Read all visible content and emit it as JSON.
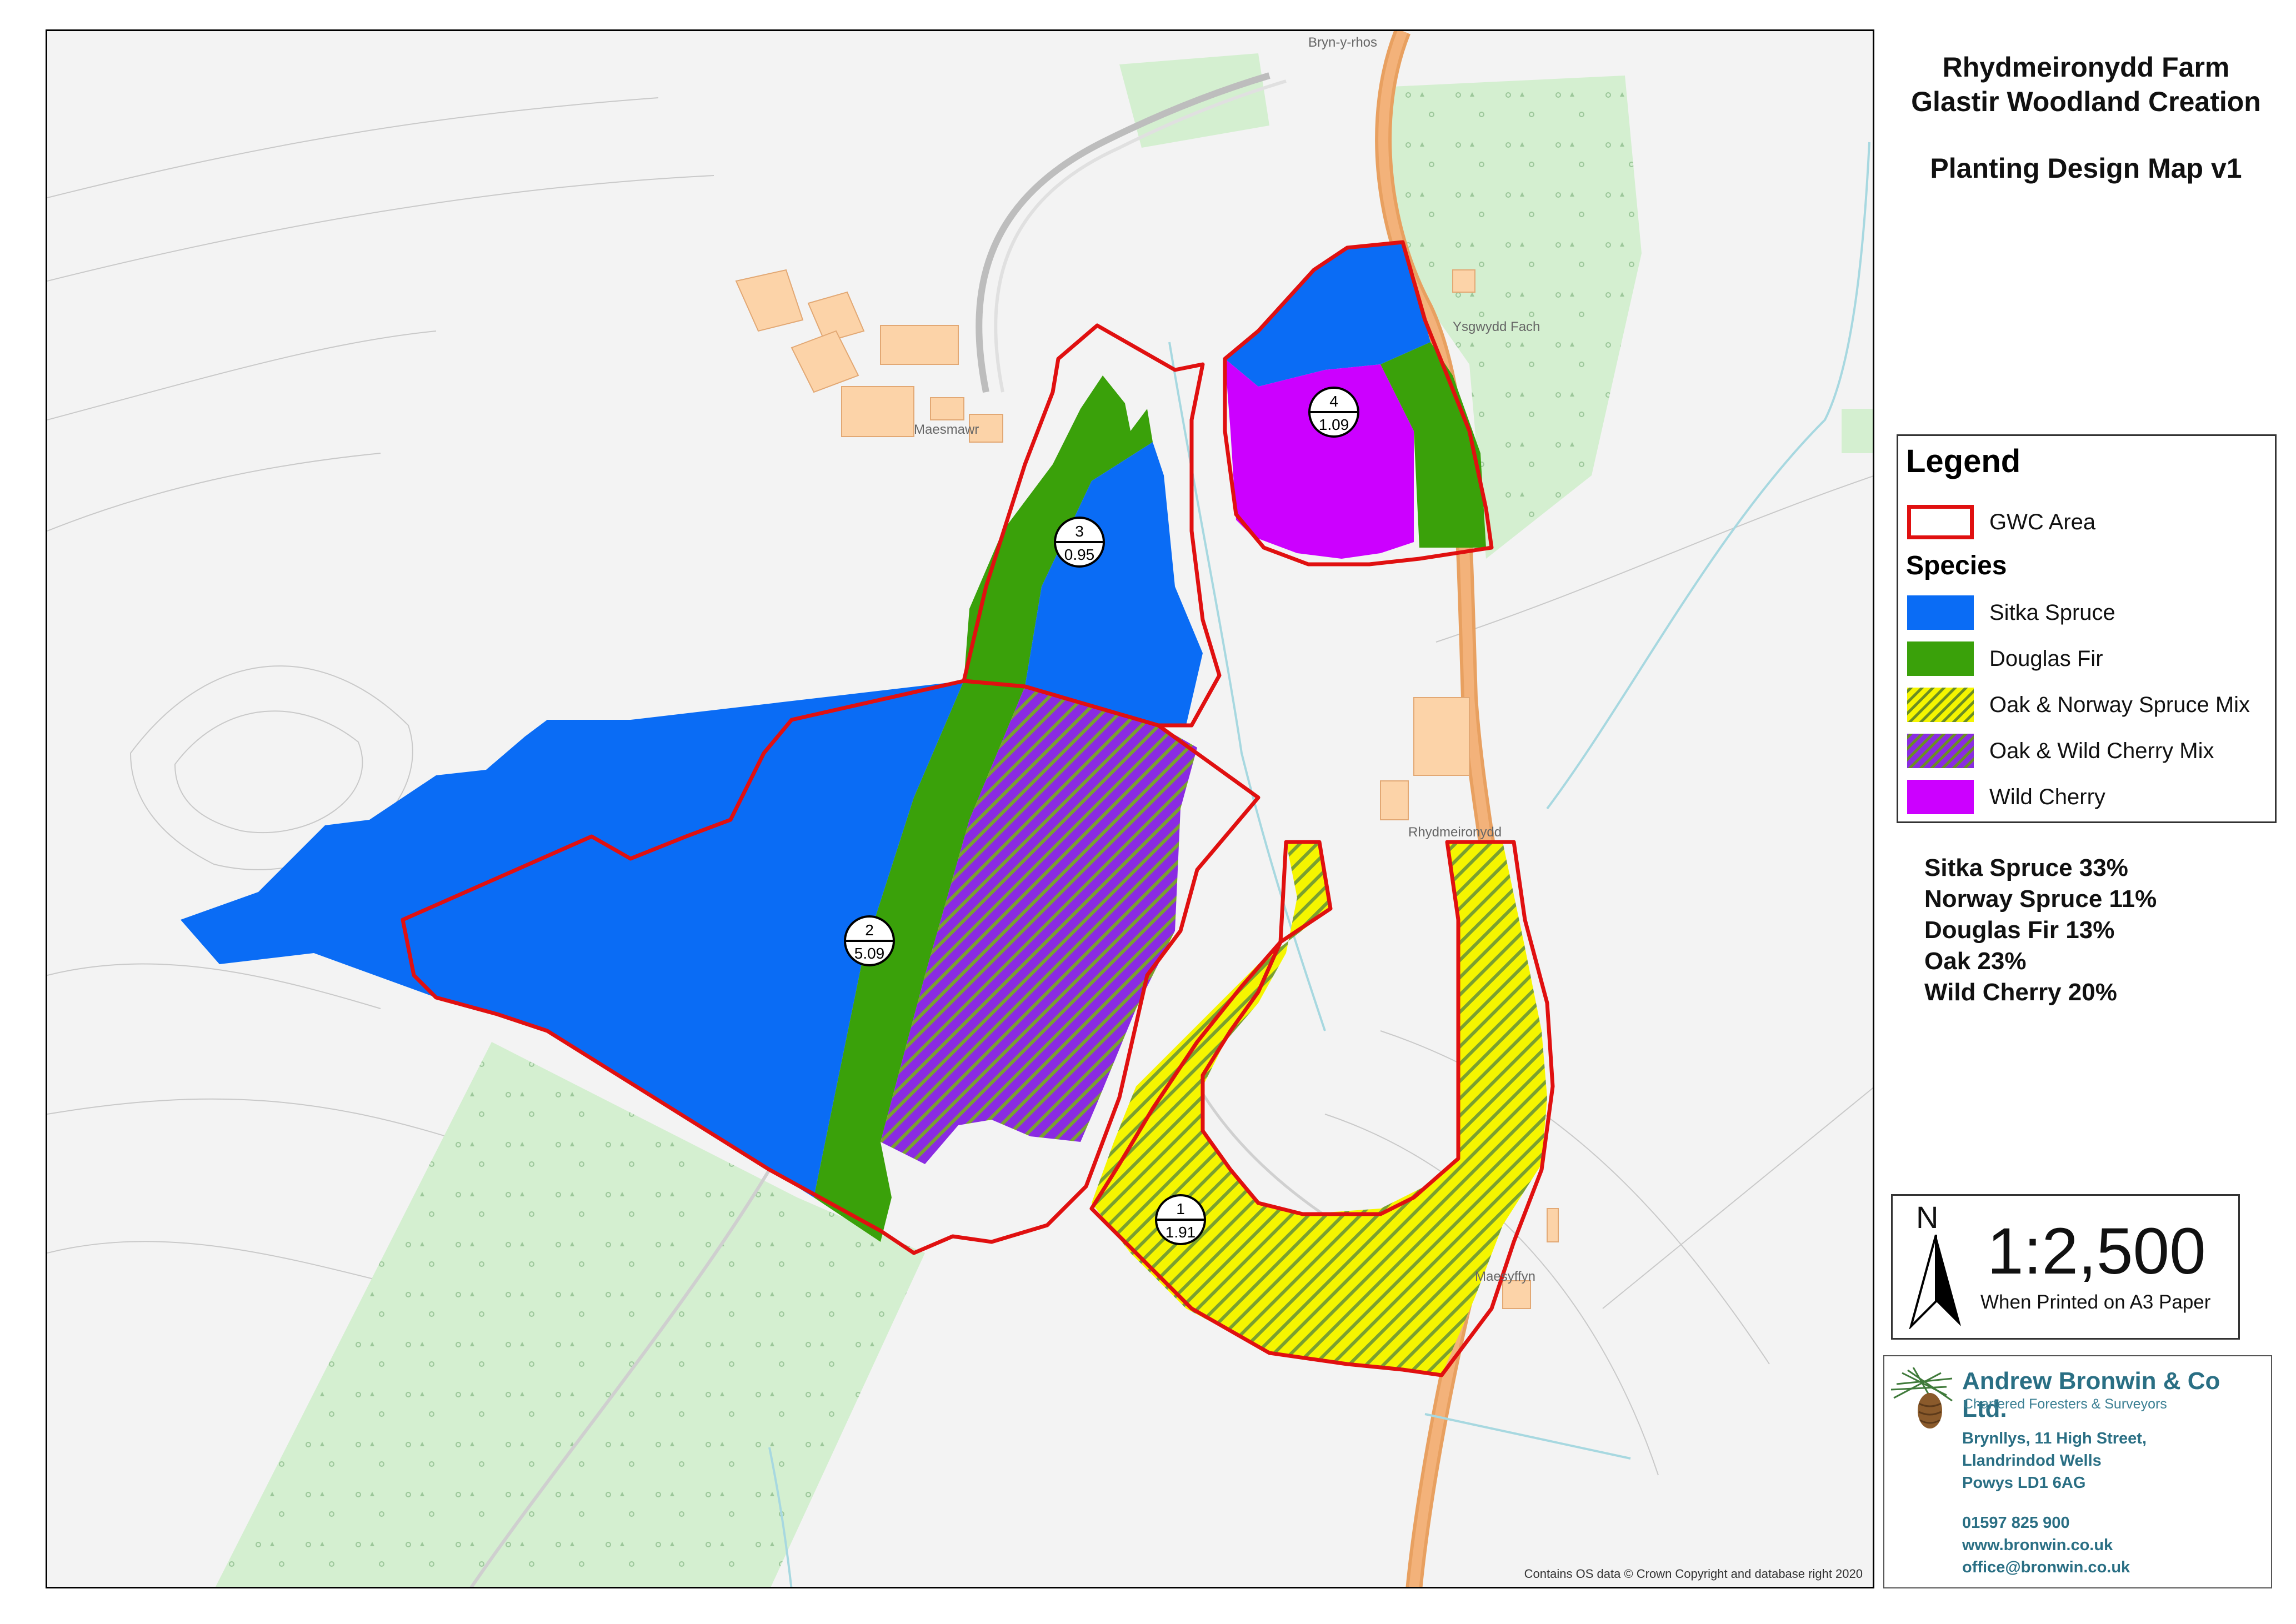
{
  "title": {
    "line1": "Rhydmeironydd Farm",
    "line2": "Glastir Woodland Creation",
    "line3": "Planting Design Map v1"
  },
  "legend": {
    "title": "Legend",
    "boundary_label": "GWC Area",
    "species_heading": "Species",
    "items": [
      {
        "label": "Sitka Spruce",
        "color": "#0a6cf5"
      },
      {
        "label": "Douglas Fir",
        "color": "#3aa10a"
      },
      {
        "label": "Oak & Norway Spruce Mix",
        "color": "#f5f500",
        "hatch": "#6b8e23"
      },
      {
        "label": "Oak & Wild Cherry Mix",
        "color": "#8a2be2",
        "hatch": "#6b8e23"
      },
      {
        "label": "Wild Cherry",
        "color": "#cc00ff"
      }
    ]
  },
  "species_mix": [
    "Sitka Spruce 33%",
    "Norway Spruce 11%",
    "Douglas Fir 13%",
    "Oak 23%",
    "Wild Cherry 20%"
  ],
  "plots": [
    {
      "id": "1",
      "area": "1.91"
    },
    {
      "id": "2",
      "area": "5.09"
    },
    {
      "id": "3",
      "area": "0.95"
    },
    {
      "id": "4",
      "area": "1.09"
    }
  ],
  "map_labels": {
    "rhydmeironydd": "Rhydmeironydd",
    "ysgwyddfach": "Ysgwydd Fach",
    "maesyffyn": "Maesyffyn",
    "maesmawr": "Maesmawr",
    "brynfarm": "Bryn-y-rhos"
  },
  "scale": {
    "north": "N",
    "ratio": "1:2,500",
    "note": "When Printed on A3 Paper"
  },
  "company": {
    "name": "Andrew Bronwin & Co Ltd.",
    "tagline": "Chartered Foresters & Surveyors",
    "address": [
      "Brynllys, 11 High Street,",
      "Llandrindod Wells",
      "Powys LD1 6AG"
    ],
    "contact": [
      "01597 825 900",
      "www.bronwin.co.uk",
      "office@bronwin.co.uk"
    ]
  },
  "copyright": "Contains OS data © Crown Copyright and database right 2020",
  "colors": {
    "boundary": "#e01010",
    "road": "#f0a060",
    "woodland": "#d4efd0",
    "building": "#fcd3a8"
  }
}
